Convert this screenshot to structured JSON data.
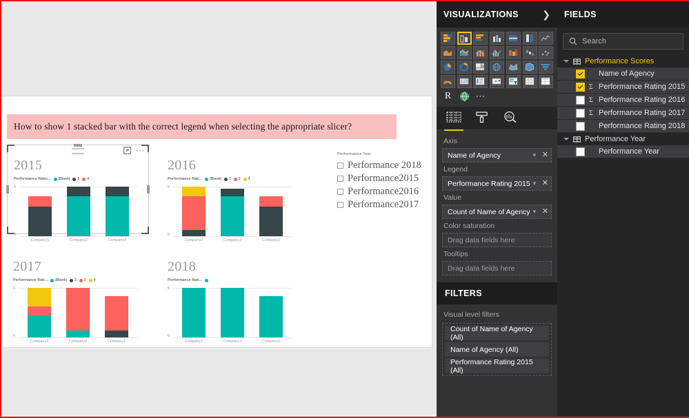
{
  "canvas": {
    "question_banner": "How to show 1 stacked bar with the correct legend when selecting the appropriate slicer?"
  },
  "slicer": {
    "header": "Performance Year",
    "items": [
      {
        "label": "Performance 2018",
        "checked": false
      },
      {
        "label": "Performance2015",
        "checked": false
      },
      {
        "label": "Performance2016",
        "checked": false
      },
      {
        "label": "Performance2017",
        "checked": false
      }
    ]
  },
  "chart_data": [
    {
      "type": "bar",
      "stacked": true,
      "title": "2015",
      "legend_title": "Performance Ratin...",
      "categories": [
        "Company1",
        "Company2",
        "Company3"
      ],
      "ylim": [
        0,
        5
      ],
      "ytick_labels": [
        "0",
        "5"
      ],
      "legend": [
        {
          "name": "(Blank)",
          "color": "#01B8AA"
        },
        {
          "name": "3",
          "color": "#374649"
        },
        {
          "name": "4",
          "color": "#FD625E"
        }
      ],
      "series": [
        {
          "name": "(Blank)",
          "color": "#01B8AA",
          "values": [
            0,
            4,
            4
          ]
        },
        {
          "name": "3",
          "color": "#374649",
          "values": [
            3,
            1,
            1
          ]
        },
        {
          "name": "4",
          "color": "#FD625E",
          "values": [
            1,
            0,
            0
          ]
        }
      ]
    },
    {
      "type": "bar",
      "stacked": true,
      "title": "2016",
      "legend_title": "Performance Rati...",
      "categories": [
        "Company2",
        "Company3",
        "Company1"
      ],
      "ylim": [
        0,
        5
      ],
      "ytick_labels": [
        "0",
        "5"
      ],
      "legend": [
        {
          "name": "(Blank)",
          "color": "#01B8AA"
        },
        {
          "name": "2",
          "color": "#374649"
        },
        {
          "name": "3",
          "color": "#FD625E"
        },
        {
          "name": "4",
          "color": "#F2C80F"
        }
      ],
      "series": [
        {
          "name": "(Blank)",
          "color": "#01B8AA",
          "values": [
            0,
            4,
            0
          ]
        },
        {
          "name": "2",
          "color": "#374649",
          "values": [
            0.6,
            0.8,
            3
          ]
        },
        {
          "name": "3",
          "color": "#FD625E",
          "values": [
            3.4,
            0,
            1
          ]
        },
        {
          "name": "4",
          "color": "#F2C80F",
          "values": [
            1,
            0,
            0
          ]
        }
      ]
    },
    {
      "type": "bar",
      "stacked": true,
      "title": "2017",
      "legend_title": "Performance Rati...",
      "categories": [
        "Company2",
        "Company3",
        "Company1"
      ],
      "ylim": [
        0,
        5
      ],
      "ytick_labels": [
        "0",
        "5"
      ],
      "legend": [
        {
          "name": "(Blank)",
          "color": "#01B8AA"
        },
        {
          "name": "2",
          "color": "#374649"
        },
        {
          "name": "3",
          "color": "#FD625E"
        },
        {
          "name": "4",
          "color": "#F2C80F"
        }
      ],
      "series": [
        {
          "name": "(Blank)",
          "color": "#01B8AA",
          "values": [
            2.2,
            0.7,
            0
          ]
        },
        {
          "name": "2",
          "color": "#374649",
          "values": [
            0,
            0,
            0.7
          ]
        },
        {
          "name": "3",
          "color": "#FD625E",
          "values": [
            0.9,
            4.3,
            3.5
          ]
        },
        {
          "name": "4",
          "color": "#F2C80F",
          "values": [
            1.9,
            0,
            0
          ]
        }
      ]
    },
    {
      "type": "bar",
      "stacked": true,
      "title": "2018",
      "legend_title": "Performance Rati...",
      "categories": [
        "Company2",
        "Company3",
        "Company1"
      ],
      "ylim": [
        0,
        5
      ],
      "ytick_labels": [
        "0",
        "5"
      ],
      "legend": [
        {
          "name": "",
          "color": "#01B8AA"
        }
      ],
      "series": [
        {
          "name": "(Blank)",
          "color": "#01B8AA",
          "values": [
            5,
            5,
            4.2
          ]
        }
      ]
    }
  ],
  "visualizations": {
    "title": "VISUALIZATIONS",
    "collapse_icon": "chevron-right-icon",
    "selected_visual": "stacked-column-chart",
    "tabs": [
      {
        "name": "fields-tab",
        "icon": "fields-grid-icon",
        "active": true
      },
      {
        "name": "format-tab",
        "icon": "paint-roller-icon",
        "active": false
      },
      {
        "name": "analytics-tab",
        "icon": "magnifier-chart-icon",
        "active": false
      }
    ],
    "wells": [
      {
        "label": "Axis",
        "value": "Name of Agency",
        "empty": false
      },
      {
        "label": "Legend",
        "value": "Performance Rating 2015",
        "empty": false
      },
      {
        "label": "Value",
        "value": "Count of Name of Agency",
        "empty": false
      },
      {
        "label": "Color saturation",
        "value": "Drag data fields here",
        "empty": true
      },
      {
        "label": "Tooltips",
        "value": "Drag data fields here",
        "empty": true
      }
    ]
  },
  "filters": {
    "title": "FILTERS",
    "subtitle": "Visual level filters",
    "items": [
      "Count of Name of Agency  (All)",
      "Name of Agency  (All)",
      "Performance Rating 2015  (All)"
    ]
  },
  "fields": {
    "title": "FIELDS",
    "search_placeholder": "Search",
    "tables": [
      {
        "name": "Performance Scores",
        "highlighted": true,
        "fields": [
          {
            "label": "Name of Agency",
            "checked": true,
            "sigma": false
          },
          {
            "label": "Performance Rating 2015",
            "checked": true,
            "sigma": true
          },
          {
            "label": "Performance Rating 2016",
            "checked": false,
            "sigma": true
          },
          {
            "label": "Performance Rating 2017",
            "checked": false,
            "sigma": true
          },
          {
            "label": "Performance Rating 2018",
            "checked": false,
            "sigma": false
          }
        ]
      },
      {
        "name": "Performance Year",
        "highlighted": false,
        "fields": [
          {
            "label": "Performance Year",
            "checked": false,
            "sigma": false
          }
        ]
      }
    ]
  },
  "colors": {
    "accent": "#F2C811",
    "teal": "#01B8AA",
    "dark": "#374649",
    "red": "#FD625E",
    "yellow": "#F2C80F",
    "banner_pink": "#F9BFBF",
    "border_red": "#EE1111"
  }
}
